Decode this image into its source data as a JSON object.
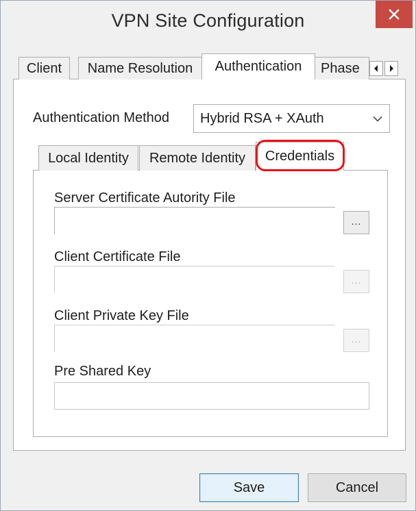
{
  "window": {
    "title": "VPN Site Configuration"
  },
  "outer_tabs": [
    {
      "label": "Client"
    },
    {
      "label": "Name Resolution"
    },
    {
      "label": "Authentication"
    },
    {
      "label": "Phase"
    }
  ],
  "auth": {
    "method_label": "Authentication Method",
    "method_value": "Hybrid RSA + XAuth"
  },
  "inner_tabs": [
    {
      "label": "Local Identity"
    },
    {
      "label": "Remote Identity"
    },
    {
      "label": "Credentials"
    }
  ],
  "credentials": {
    "server_ca_label": "Server Certificate Autority File",
    "server_ca_value": "",
    "client_cert_label": "Client Certificate File",
    "client_cert_value": "",
    "client_key_label": "Client Private Key File",
    "client_key_value": "",
    "psk_label": "Pre Shared Key",
    "psk_value": "",
    "browse_label": "..."
  },
  "buttons": {
    "save": "Save",
    "cancel": "Cancel"
  },
  "icons": {
    "close": "close-icon",
    "tab_left": "arrow-left-icon",
    "tab_right": "arrow-right-icon",
    "dropdown": "chevron-down-icon"
  },
  "colors": {
    "close_button": "#c74a42",
    "highlight": "#e8141a",
    "save_border": "#3c7fb1"
  }
}
